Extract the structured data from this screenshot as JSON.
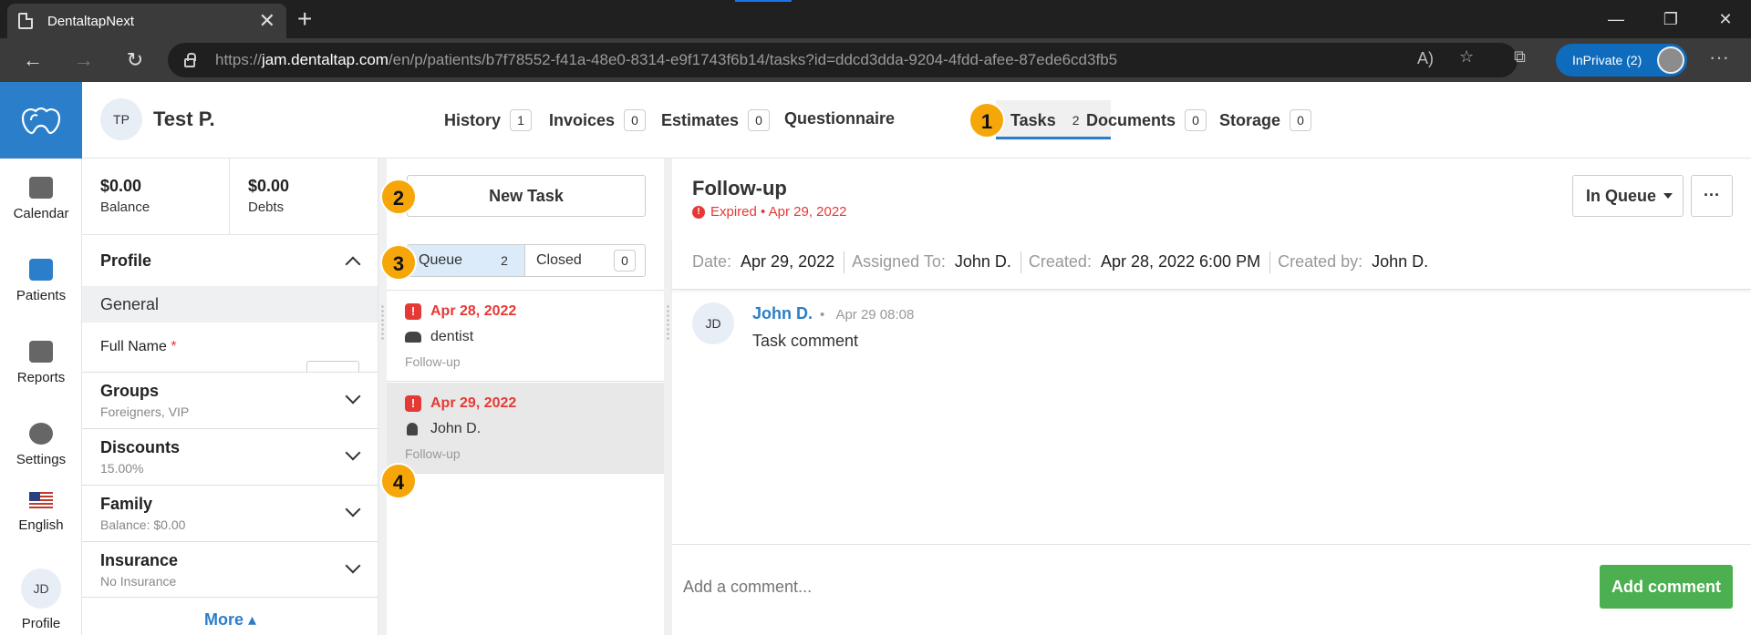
{
  "browser": {
    "tab_title": "DentaltapNext",
    "url_prefix": "https://",
    "url_host": "jam.dentaltap.com",
    "url_path": "/en/p/patients/b7f78552-f41a-48e0-8314-e9f1743f6b14/tasks?id=ddcd3dda-9204-4fdd-afee-87ede6cd3fb5",
    "inprivate_label": "InPrivate (2)"
  },
  "leftnav": {
    "items": [
      {
        "label": "Calendar",
        "icon": "calendar-icon"
      },
      {
        "label": "Patients",
        "icon": "patients-icon"
      },
      {
        "label": "Reports",
        "icon": "reports-icon"
      },
      {
        "label": "Settings",
        "icon": "settings-icon"
      },
      {
        "label": "English",
        "icon": "us-flag-icon"
      },
      {
        "label": "Profile",
        "initials": "JD"
      }
    ]
  },
  "patient": {
    "initials": "TP",
    "name": "Test P."
  },
  "patient_tabs": [
    {
      "label": "History",
      "count": "1"
    },
    {
      "label": "Invoices",
      "count": "0"
    },
    {
      "label": "Estimates",
      "count": "0"
    },
    {
      "label": "Questionnaire",
      "count": ""
    },
    {
      "label": "Tasks",
      "count": "2"
    },
    {
      "label": "Documents",
      "count": "0"
    },
    {
      "label": "Storage",
      "count": "0"
    }
  ],
  "profile_panel": {
    "balance_amount": "$0.00",
    "balance_label": "Balance",
    "debts_amount": "$0.00",
    "debts_label": "Debts",
    "profile_title": "Profile",
    "general_label": "General",
    "full_name_label": "Full Name",
    "required_mark": "*",
    "sections": [
      {
        "title": "Groups",
        "subtitle": "Foreigners, VIP"
      },
      {
        "title": "Discounts",
        "subtitle": "15.00%"
      },
      {
        "title": "Family",
        "subtitle": "Balance: $0.00"
      },
      {
        "title": "Insurance",
        "subtitle": "No Insurance"
      }
    ],
    "more_label": "More ▴"
  },
  "tasks": {
    "new_task_label": "New Task",
    "queue_label": "Queue",
    "queue_count": "2",
    "closed_label": "Closed",
    "closed_count": "0",
    "items": [
      {
        "date": "Apr 28, 2022",
        "assignee": "dentist",
        "type": "Follow-up",
        "selected": false
      },
      {
        "date": "Apr 29, 2022",
        "assignee": "John D.",
        "type": "Follow-up",
        "selected": true
      }
    ]
  },
  "detail": {
    "title": "Follow-up",
    "expired_text": "Expired • Apr 29, 2022",
    "status_label": "In Queue",
    "more_label": "···",
    "meta": {
      "date_key": "Date:",
      "date_val": "Apr 29, 2022",
      "assigned_key": "Assigned To:",
      "assigned_val": "John D.",
      "created_key": "Created:",
      "created_val": "Apr 28, 2022 6:00 PM",
      "createdby_key": "Created by:",
      "createdby_val": "John D."
    },
    "comment": {
      "initials": "JD",
      "author": "John D.",
      "separator": "•",
      "timestamp": "Apr 29 08:08",
      "text": "Task comment"
    },
    "comment_placeholder": "Add a comment...",
    "add_comment_label": "Add comment"
  },
  "steps": [
    "1",
    "2",
    "3",
    "4"
  ],
  "colors": {
    "brand": "#2b7ec9",
    "expired": "#e53935",
    "add_comment": "#4caf50",
    "step_marker": "#f6a609"
  }
}
